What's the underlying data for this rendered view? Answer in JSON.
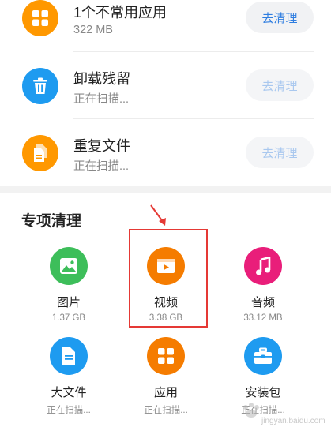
{
  "clean_list": [
    {
      "title": "1个不常用应用",
      "subtitle": "322 MB",
      "button": "去清理",
      "icon": "apps-grid-icon",
      "color": "#FF9800",
      "enabled": true
    },
    {
      "title": "卸载残留",
      "subtitle": "正在扫描...",
      "button": "去清理",
      "icon": "trash-icon",
      "color": "#1E9BF0",
      "enabled": false
    },
    {
      "title": "重复文件",
      "subtitle": "正在扫描...",
      "button": "去清理",
      "icon": "duplicate-files-icon",
      "color": "#FF9800",
      "enabled": false
    }
  ],
  "special_section": {
    "title": "专项清理",
    "items": [
      {
        "name": "图片",
        "size": "1.37 GB",
        "icon": "image-icon",
        "color": "#3DBE5A"
      },
      {
        "name": "视频",
        "size": "3.38 GB",
        "icon": "video-icon",
        "color": "#F57C00"
      },
      {
        "name": "音频",
        "size": "33.12 MB",
        "icon": "music-icon",
        "color": "#E91E7A"
      },
      {
        "name": "大文件",
        "size": "正在扫描...",
        "icon": "document-icon",
        "color": "#1E9BF0"
      },
      {
        "name": "应用",
        "size": "正在扫描...",
        "icon": "apps-grid-icon",
        "color": "#F57C00"
      },
      {
        "name": "安装包",
        "size": "正在扫描...",
        "icon": "toolbox-icon",
        "color": "#1E9BF0"
      }
    ]
  },
  "watermark": {
    "text": "jingyan.baidu.com"
  }
}
